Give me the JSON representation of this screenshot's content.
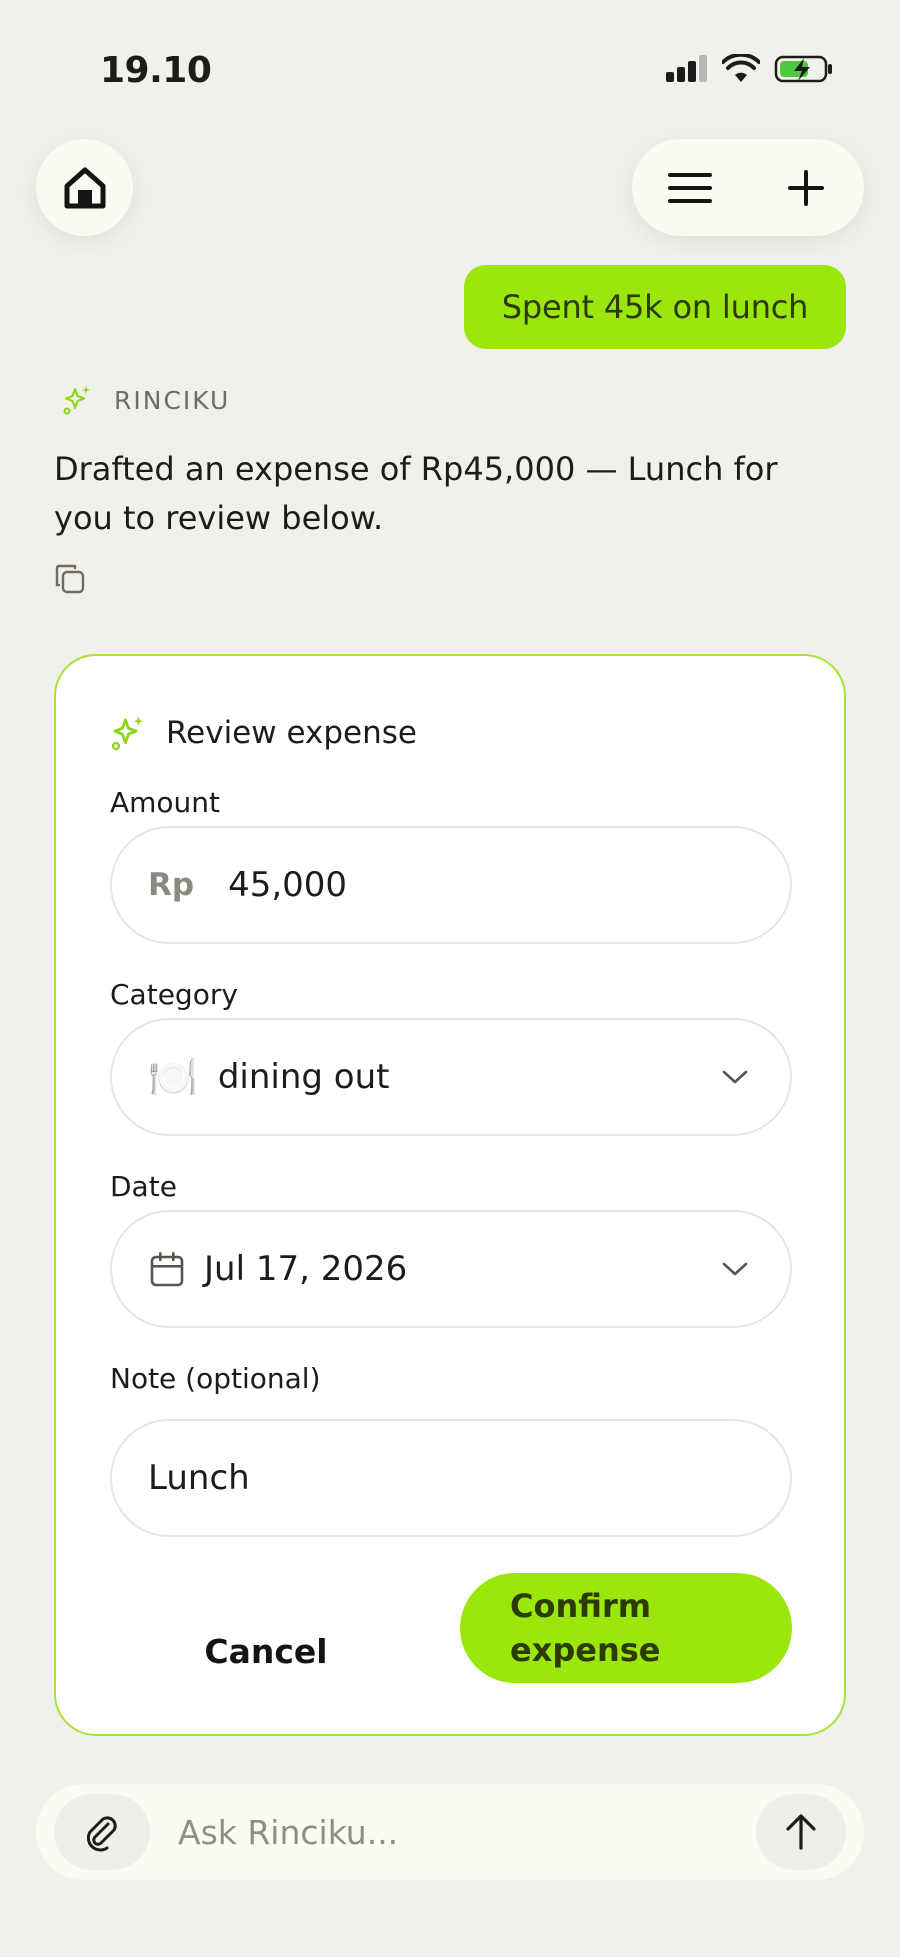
{
  "status_bar": {
    "time": "19.10",
    "icons": [
      "cellular-signal-icon",
      "wifi-icon",
      "battery-charging-icon"
    ]
  },
  "top_bar": {
    "icons": [
      "home-icon",
      "menu-icon",
      "plus-icon"
    ]
  },
  "chat": {
    "user_message": "Spent 45k on lunch",
    "assistant_name": "RINCIKU",
    "assistant_message": "Drafted an expense of Rp45,000 — Lunch for you to review below."
  },
  "review_card": {
    "title": "Review expense",
    "amount": {
      "label": "Amount",
      "currency": "Rp",
      "value": "45,000"
    },
    "category": {
      "label": "Category",
      "emoji": "🍽️",
      "value": "dining out"
    },
    "date": {
      "label": "Date",
      "value": "Jul 17, 2026"
    },
    "note": {
      "label": "Note (optional)",
      "value": "Lunch"
    },
    "cancel_label": "Cancel",
    "confirm_label": "Confirm expense"
  },
  "composer": {
    "placeholder": "Ask Rinciku..."
  },
  "colors": {
    "accent": "#9be60c",
    "background": "#f1f0ea",
    "card_border": "#a8e23a"
  }
}
